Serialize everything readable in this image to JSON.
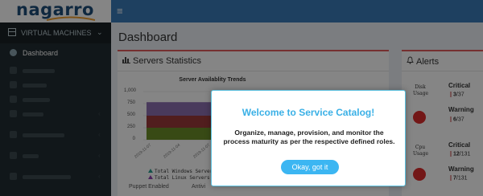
{
  "app": {
    "logo_text": "nagarro"
  },
  "sidebar": {
    "section_label": "VIRTUAL MACHINES",
    "items": [
      {
        "label": "Dashboard"
      }
    ]
  },
  "page": {
    "title": "Dashboard"
  },
  "stats": {
    "title": "Servers Statistics",
    "footer_left": "Puppet Enabled",
    "footer_mid": "Antivi"
  },
  "chart_data": {
    "type": "area",
    "title": "Server Availablity Trends",
    "yticks": [
      "1,000",
      "750",
      "500",
      "250",
      "0"
    ],
    "ylim": [
      0,
      1000
    ],
    "categories": [
      "2019-11-07",
      "2019-11-04",
      "2019-11-07",
      "2019-11-08",
      "2019-11-09",
      "2019-11-10"
    ],
    "series": [
      {
        "name": "Total Windows Servers",
        "color": "#4aa84a",
        "values": [
          250,
          250,
          250,
          250,
          250,
          250
        ]
      },
      {
        "name": "Total Linux Servers",
        "color": "#9b6fb3",
        "values": [
          500,
          500,
          500,
          500,
          500,
          500
        ]
      }
    ],
    "band_colors": [
      "#6b8f2a",
      "#9b3a3a",
      "#8d6fb0"
    ]
  },
  "alerts": {
    "title": "Alerts",
    "items": [
      {
        "name": "Disk Usage",
        "level1": "Critical",
        "value1": "3",
        "total1": "37",
        "level2": "Warning",
        "value2": "6",
        "total2": "37"
      },
      {
        "name": "Cpu Usage",
        "level1": "Critical",
        "value1": "12",
        "total1": "131",
        "level2": "Warning",
        "value2": "7",
        "total2": "131"
      }
    ]
  },
  "modal": {
    "title": "Welcome to Service Catalog!",
    "body": "Organize, manage, provision, and monitor the process maturity as per the respective defined roles.",
    "button_label": "Okay, got it"
  },
  "colors": {
    "topbar": "#3a7bb8",
    "sidebar": "#222d32",
    "accent": "#3ab0e6",
    "alert_red": "#dd2c2c",
    "box_border": "#e05d5d"
  }
}
